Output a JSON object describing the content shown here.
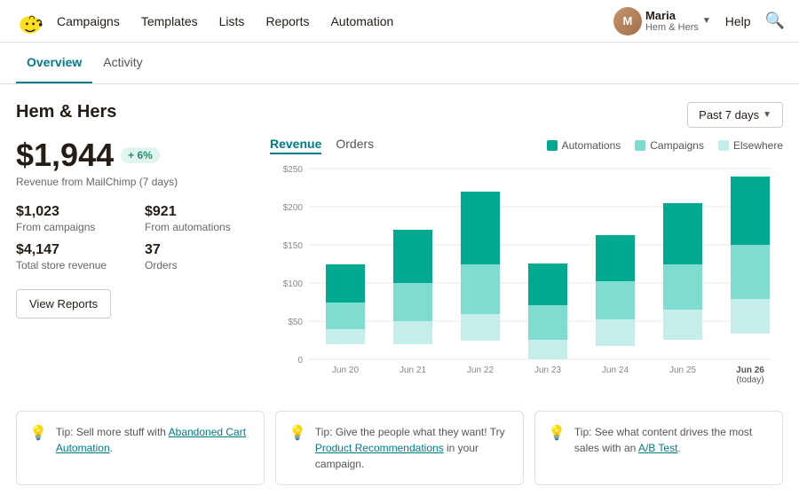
{
  "nav": {
    "links": [
      "Campaigns",
      "Templates",
      "Lists",
      "Reports",
      "Automation"
    ],
    "user": {
      "name": "Maria",
      "org": "Hem & Hers"
    },
    "help": "Help"
  },
  "tabs": [
    {
      "label": "Overview",
      "active": true
    },
    {
      "label": "Activity",
      "active": false
    }
  ],
  "store": {
    "name": "Hem & Hers",
    "date_range": "Past 7 days"
  },
  "revenue": {
    "value": "$1,944",
    "badge": "+ 6%",
    "label": "Revenue from MailChimp (7 days)"
  },
  "stats": [
    {
      "value": "$1,023",
      "label": "From campaigns"
    },
    {
      "value": "$921",
      "label": "From automations"
    },
    {
      "value": "$4,147",
      "label": "Total store revenue"
    },
    {
      "value": "37",
      "label": "Orders"
    }
  ],
  "view_reports_btn": "View Reports",
  "chart": {
    "tabs": [
      "Revenue",
      "Orders"
    ],
    "active_tab": "Revenue",
    "legend": [
      {
        "label": "Automations",
        "color": "#00a98f"
      },
      {
        "label": "Campaigns",
        "color": "#7eddd0"
      },
      {
        "label": "Elsewhere",
        "color": "#c5eeea"
      }
    ],
    "bars": [
      {
        "date": "Jun 20",
        "automations": 50,
        "campaigns": 35,
        "elsewhere": 20
      },
      {
        "date": "Jun 21",
        "automations": 70,
        "campaigns": 50,
        "elsewhere": 30
      },
      {
        "date": "Jun 22",
        "automations": 95,
        "campaigns": 65,
        "elsewhere": 35
      },
      {
        "date": "Jun 23",
        "automations": 55,
        "campaigns": 45,
        "elsewhere": 25
      },
      {
        "date": "Jun 24",
        "automations": 60,
        "campaigns": 50,
        "elsewhere": 35
      },
      {
        "date": "Jun 25",
        "automations": 80,
        "campaigns": 60,
        "elsewhere": 40
      },
      {
        "date": "Jun 26",
        "automations": 90,
        "campaigns": 70,
        "elsewhere": 45,
        "today": true
      }
    ],
    "y_labels": [
      "$250",
      "$200",
      "$150",
      "$100",
      "$50",
      "0"
    ]
  },
  "tips": [
    {
      "prefix": "Tip: Sell more stuff with ",
      "link_text": "Abandoned Cart Automation",
      "suffix": ".",
      "link": "#"
    },
    {
      "prefix": "Tip: Give the people what they want! Try ",
      "link_text": "Product Recommendations",
      "suffix": " in your campaign.",
      "link": "#"
    },
    {
      "prefix": "Tip: See what content drives the most sales with an ",
      "link_text": "A/B Test",
      "suffix": ".",
      "link": "#"
    }
  ]
}
